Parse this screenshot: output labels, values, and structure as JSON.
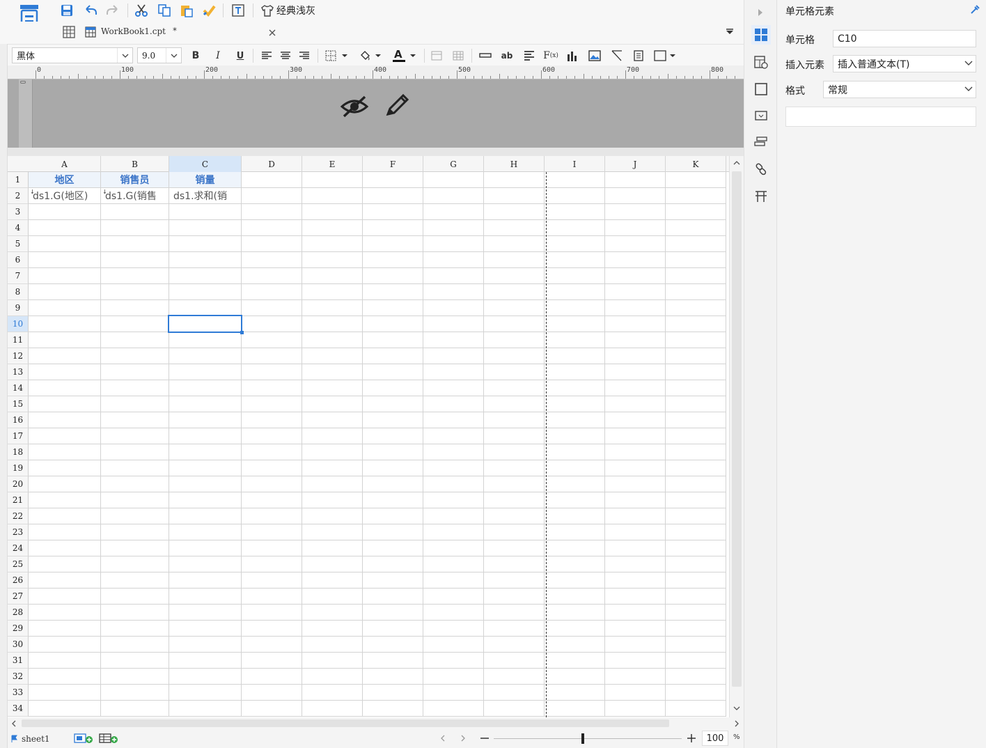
{
  "toolbar": {
    "theme_label": "经典浅灰"
  },
  "tab": {
    "filename": "WorkBook1.cpt",
    "modified": "*"
  },
  "format": {
    "font_name": "黑体",
    "font_size": "9.0"
  },
  "ruler": {
    "labels": [
      "0",
      "100",
      "200",
      "300",
      "400",
      "500",
      "600",
      "700",
      "800"
    ]
  },
  "grid": {
    "columns": [
      "A",
      "B",
      "C",
      "D",
      "E",
      "F",
      "G",
      "H",
      "I",
      "J",
      "K"
    ],
    "rows": [
      "1",
      "2",
      "3",
      "4",
      "5",
      "6",
      "7",
      "8",
      "9",
      "10",
      "11",
      "12",
      "13",
      "14",
      "15",
      "16",
      "17",
      "18",
      "19",
      "20",
      "21",
      "22",
      "23",
      "24",
      "25",
      "26",
      "27",
      "28",
      "29",
      "30",
      "31",
      "32",
      "33",
      "34"
    ],
    "header_row": [
      "地区",
      "销售员",
      "销量"
    ],
    "data_row": [
      "ds1.G(地区)",
      "ds1.G(销售",
      "ds1.求和(销"
    ],
    "selected_cell": "C10",
    "selected_column": "C",
    "selected_row": "10"
  },
  "status": {
    "sheet_name": "sheet1",
    "zoom": "100",
    "zoom_unit": "%"
  },
  "panel": {
    "title": "单元格元素",
    "cell_label": "单元格",
    "cell_value": "C10",
    "insert_label": "插入元素",
    "insert_value": "插入普通文本(T)",
    "format_label": "格式",
    "format_value": "常规"
  },
  "colors": {
    "accent": "#2f7bd6",
    "header_text": "#3a74c8",
    "grid_line": "#d3d3d3",
    "paper": "#a9a9a9"
  }
}
